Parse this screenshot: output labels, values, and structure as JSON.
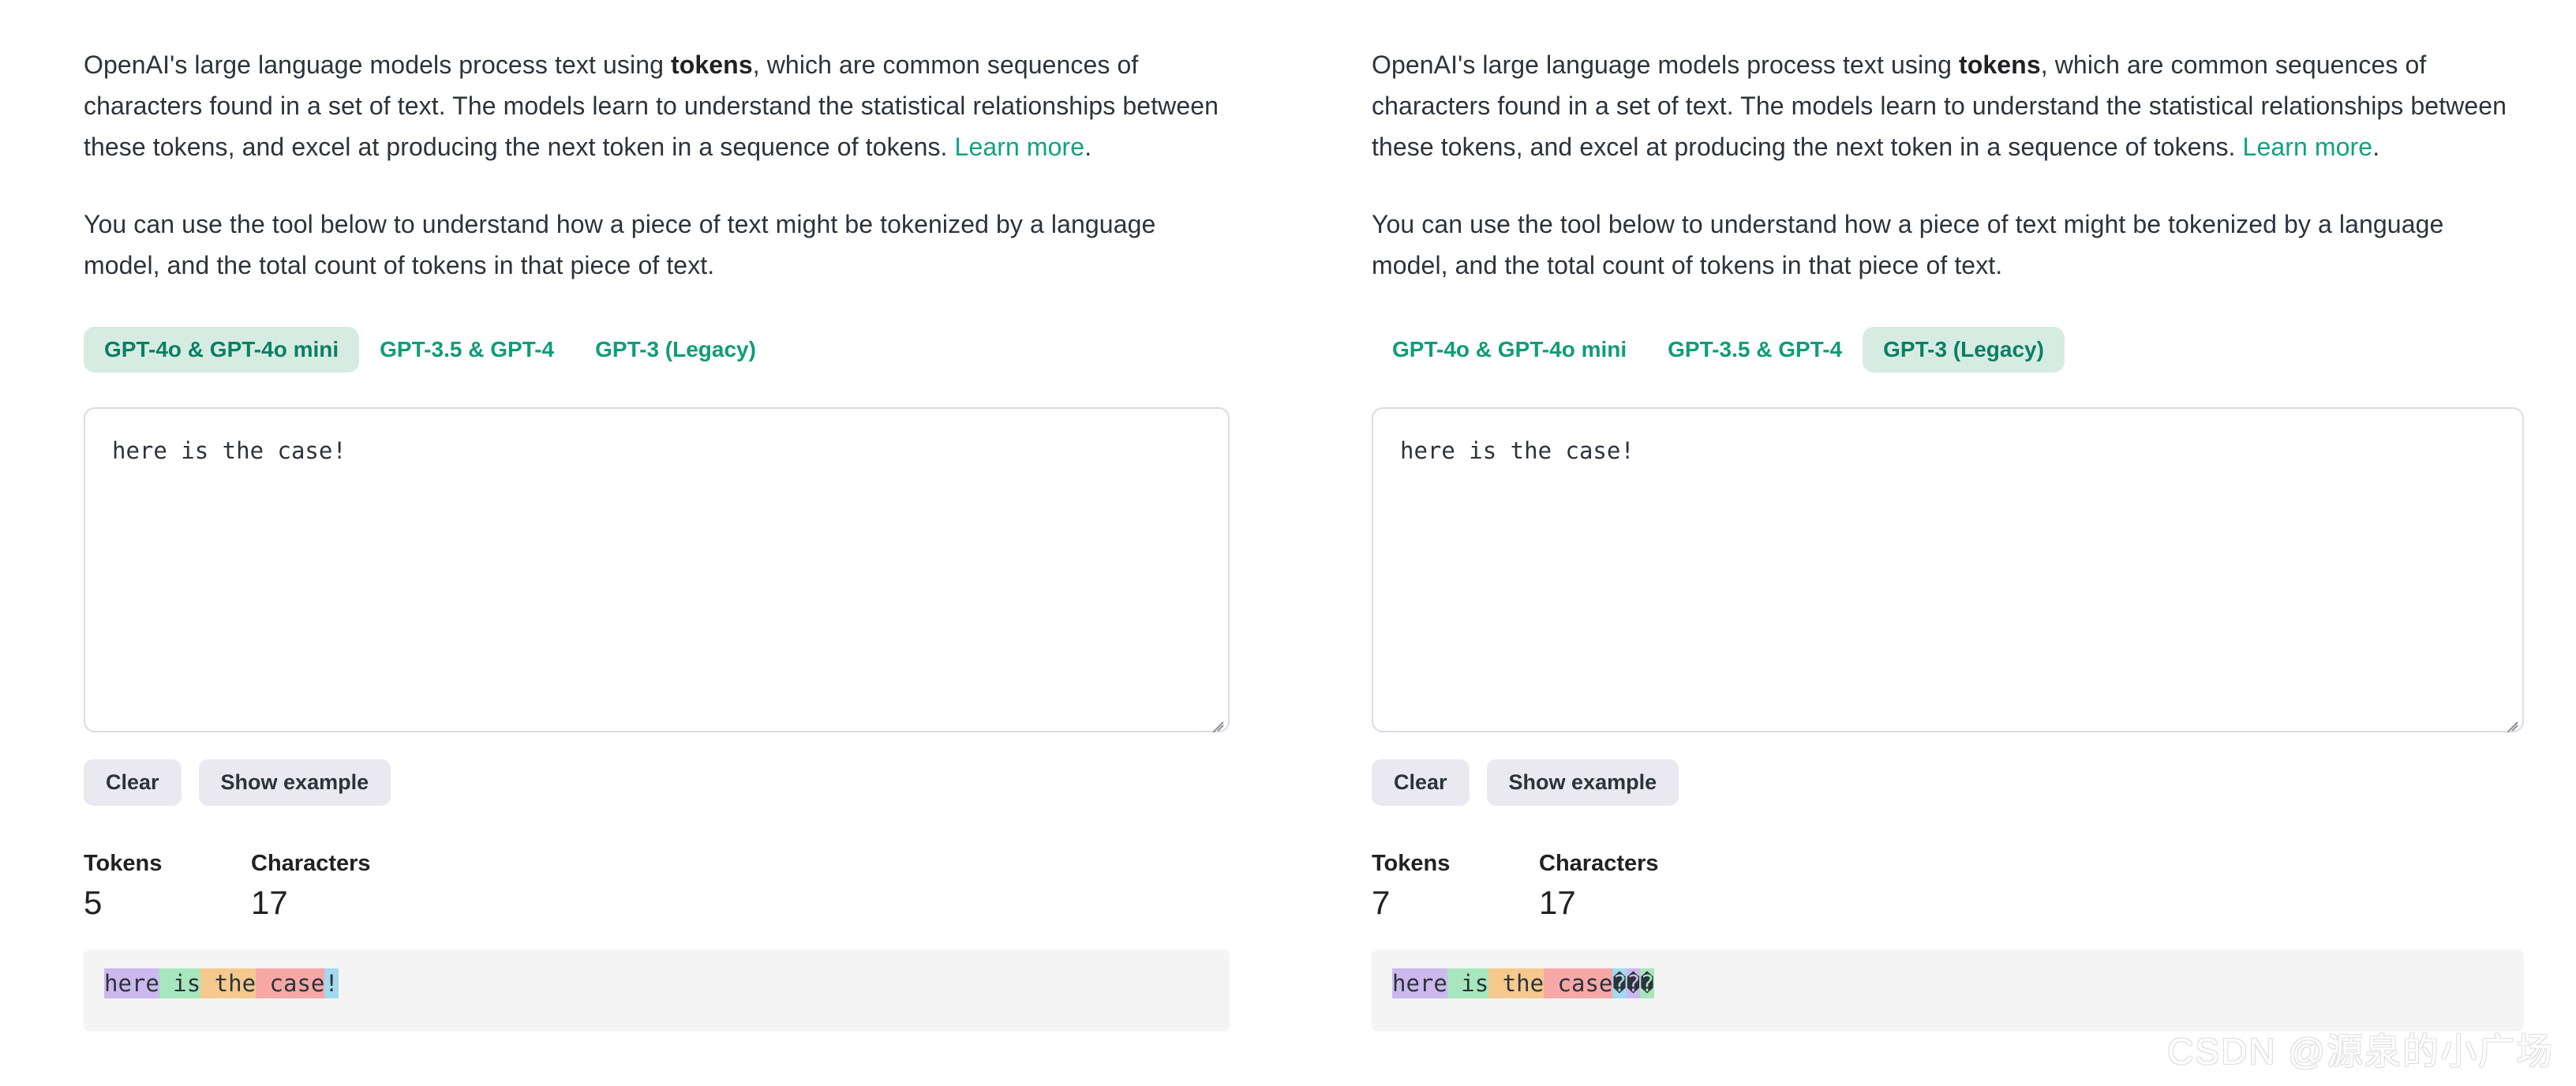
{
  "intro": {
    "p1_before_bold": "OpenAI's large language models process text using ",
    "p1_bold": "tokens",
    "p1_after_bold": ", which are common sequences of characters found in a set of text. The models learn to understand the statistical relationships between these tokens, and excel at producing the next token in a sequence of tokens. ",
    "link_label": "Learn more",
    "p1_end": ".",
    "p2": "You can use the tool below to understand how a piece of text might be tokenized by a language model, and the total count of tokens in that piece of text."
  },
  "tabs": [
    {
      "id": "gpt4o",
      "label": "GPT-4o & GPT-4o mini"
    },
    {
      "id": "gpt35",
      "label": "GPT-3.5 & GPT-4"
    },
    {
      "id": "gpt3",
      "label": "GPT-3 (Legacy)"
    }
  ],
  "buttons": {
    "clear": "Clear",
    "show_example": "Show example"
  },
  "stats_labels": {
    "tokens": "Tokens",
    "characters": "Characters"
  },
  "colors": {
    "accent_green": "#10a37f",
    "tab_active_bg": "#d6ece3",
    "tab_active_text": "#0b7f62",
    "button_bg": "#e9e9ef",
    "token_purple": "#cbb9ee",
    "token_green": "#a8e6bd",
    "token_orange": "#f5c98d",
    "token_pink": "#f8a7a7",
    "token_blue": "#a3d9ee",
    "token_panel_bg": "#f4f4f4"
  },
  "left": {
    "active_tab": "gpt4o",
    "textarea_value": "here is the case!",
    "textarea_placeholder": "Enter some text",
    "tokens": "5",
    "characters": "17",
    "token_pieces": [
      {
        "text": "here",
        "color": "#cbb9ee"
      },
      {
        "text": " is",
        "color": "#a8e6bd"
      },
      {
        "text": " the",
        "color": "#f5c98d"
      },
      {
        "text": " case",
        "color": "#f8a7a7"
      },
      {
        "text": "!",
        "color": "#a3d9ee"
      }
    ]
  },
  "right": {
    "active_tab": "gpt3",
    "textarea_value": "here is the case!",
    "textarea_placeholder": "Enter some text",
    "tokens": "7",
    "characters": "17",
    "token_pieces": [
      {
        "text": "here",
        "color": "#cbb9ee"
      },
      {
        "text": " is",
        "color": "#a8e6bd"
      },
      {
        "text": " the",
        "color": "#f5c98d"
      },
      {
        "text": " case",
        "color": "#f8a7a7"
      },
      {
        "text": "�",
        "color": "#a3d9ee"
      },
      {
        "text": "�",
        "color": "#cbb9ee"
      },
      {
        "text": "�",
        "color": "#a8e6bd"
      }
    ]
  },
  "watermark": "CSDN @源泉的小广场"
}
